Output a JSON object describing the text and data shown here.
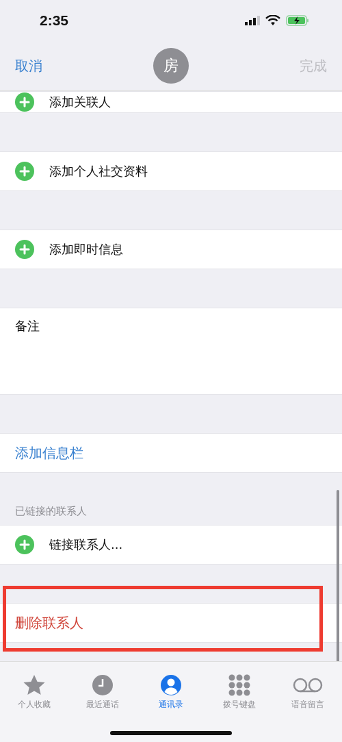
{
  "status_bar": {
    "time": "2:35"
  },
  "nav": {
    "cancel": "取消",
    "avatar": "房",
    "done": "完成",
    "done_disabled": true
  },
  "sections": [
    {
      "kind": "add",
      "label": "添加关联人",
      "partial": true
    },
    {
      "kind": "add",
      "label": "添加个人社交资料"
    },
    {
      "kind": "add",
      "label": "添加即时信息"
    },
    {
      "kind": "notes",
      "label": "备注"
    },
    {
      "kind": "link",
      "label": "添加信息栏"
    },
    {
      "kind": "add",
      "label": "链接联系人...",
      "header": "已链接的联系人"
    },
    {
      "kind": "destructive",
      "label": "删除联系人",
      "annotated": true
    }
  ],
  "tabs": [
    {
      "kind": "star",
      "label": "个人收藏",
      "selected": false
    },
    {
      "kind": "clock",
      "label": "最近通话",
      "selected": false
    },
    {
      "kind": "person",
      "label": "通讯录",
      "selected": true
    },
    {
      "kind": "keypad",
      "label": "拨号键盘",
      "selected": false
    },
    {
      "kind": "voicemail",
      "label": "语音留言",
      "selected": false
    }
  ]
}
